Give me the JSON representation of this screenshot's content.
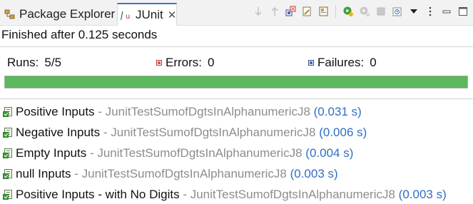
{
  "tabs": {
    "package_explorer": {
      "label": "Package Explorer",
      "icon": "package-explorer-icon"
    },
    "junit": {
      "label": "JUnit",
      "close": "✕",
      "icon": "junit-icon"
    }
  },
  "toolbar": {
    "icons": [
      "next-failure-icon",
      "previous-failure-icon",
      "failures-only-icon",
      "scroll-lock-icon",
      "show-skipped-icon",
      "rerun-icon",
      "rerun-failed-first-icon",
      "stop-icon",
      "history-icon",
      "view-menu-icon",
      "minimize-icon",
      "maximize-icon"
    ]
  },
  "status": {
    "text": "Finished after 0.125 seconds"
  },
  "counters": {
    "runs": {
      "label": "Runs:",
      "value": "5/5"
    },
    "errors": {
      "label": "Errors:",
      "value": "0"
    },
    "failures": {
      "label": "Failures:",
      "value": "0"
    }
  },
  "progress": {
    "fraction": 1.0,
    "color": "#5cb85c"
  },
  "tests": [
    {
      "name": "Positive Inputs",
      "sep": " - ",
      "cls": "JunitTestSumofDgtsInAlphanumericJ8",
      "time": " (0.031 s)"
    },
    {
      "name": "Negative Inputs",
      "sep": " - ",
      "cls": "JunitTestSumofDgtsInAlphanumericJ8",
      "time": " (0.006 s)"
    },
    {
      "name": "Empty Inputs",
      "sep": " - ",
      "cls": "JunitTestSumofDgtsInAlphanumericJ8",
      "time": " (0.004 s)"
    },
    {
      "name": "null Inputs",
      "sep": " - ",
      "cls": "JunitTestSumofDgtsInAlphanumericJ8",
      "time": " (0.003 s)"
    },
    {
      "name": "Positive Inputs - with No Digits",
      "sep": " - ",
      "cls": "JunitTestSumofDgtsInAlphanumericJ8",
      "time": " (0.003 s)"
    }
  ]
}
